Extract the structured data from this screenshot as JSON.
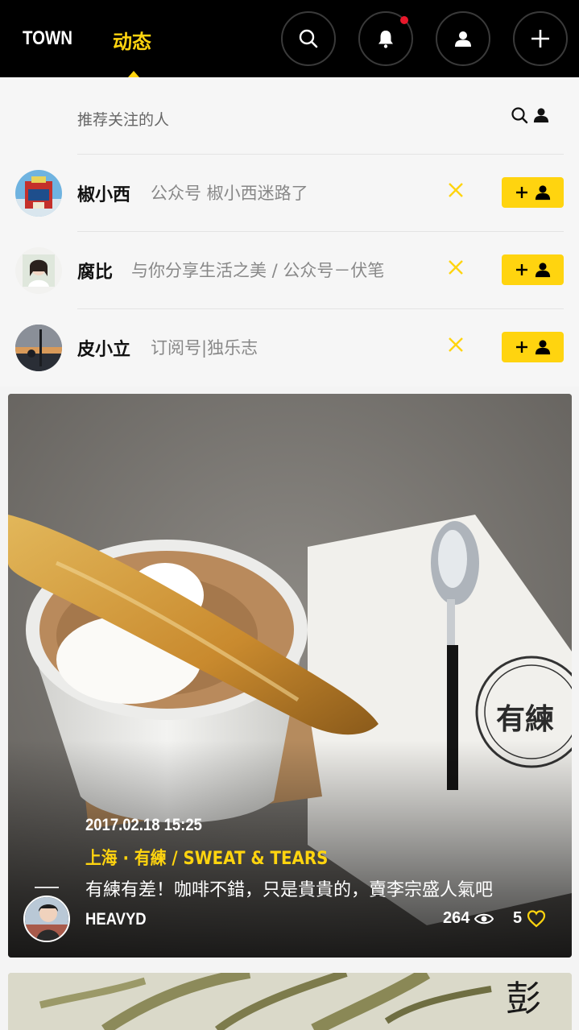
{
  "header": {
    "tab_town": "TOWN",
    "tab_dongtai": "动态",
    "accent_color": "#ffd40f",
    "buttons": [
      "search-icon",
      "bell-icon",
      "user-icon",
      "plus-icon"
    ],
    "notification_dot_color": "#e8182b"
  },
  "suggest": {
    "title": "推荐关注的人",
    "users": [
      {
        "name": "椒小西",
        "desc": "公众号 椒小西迷路了"
      },
      {
        "name": "腐比",
        "desc": "与你分享生活之美 / 公众号－伏笔"
      },
      {
        "name": "皮小立",
        "desc": "订阅号|独乐志"
      }
    ]
  },
  "post": {
    "date": "2017.02.18 15:25",
    "location": "上海 · 有練 / SWEAT & TEARS",
    "text": "有練有差！咖啡不錯，只是貴貴的，賣李宗盛人氣吧",
    "username": "HEAVYD",
    "views": "264",
    "likes": "5",
    "cafe_logo_text": "有練"
  },
  "next_card": {
    "corner_text": "彭"
  }
}
